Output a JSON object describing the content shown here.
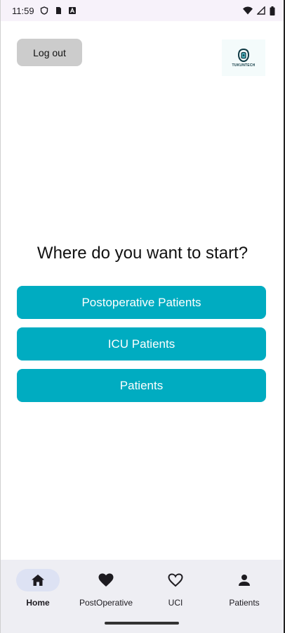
{
  "status_bar": {
    "time": "11:59",
    "left_icons": [
      "shield-icon",
      "sim-card-icon",
      "a-badge-icon"
    ],
    "right_icons": [
      "wifi-icon",
      "cellular-signal-icon",
      "battery-icon"
    ]
  },
  "header": {
    "logout_label": "Log out",
    "logo_text": "TUKUNTECH"
  },
  "main": {
    "headline": "Where do you want to start?",
    "options": [
      {
        "label": "Postoperative Patients"
      },
      {
        "label": "ICU Patients"
      },
      {
        "label": "Patients"
      }
    ]
  },
  "bottom_nav": {
    "items": [
      {
        "label": "Home",
        "icon": "home-icon",
        "active": true
      },
      {
        "label": "PostOperative",
        "icon": "heart-filled-icon",
        "active": false
      },
      {
        "label": "UCI",
        "icon": "heart-outline-icon",
        "active": false
      },
      {
        "label": "Patients",
        "icon": "person-icon",
        "active": false
      }
    ]
  },
  "colors": {
    "accent": "#00acc1",
    "logout_bg": "#cccccc",
    "nav_bg": "#eeeef3",
    "nav_active_pill": "#dde2f3"
  }
}
